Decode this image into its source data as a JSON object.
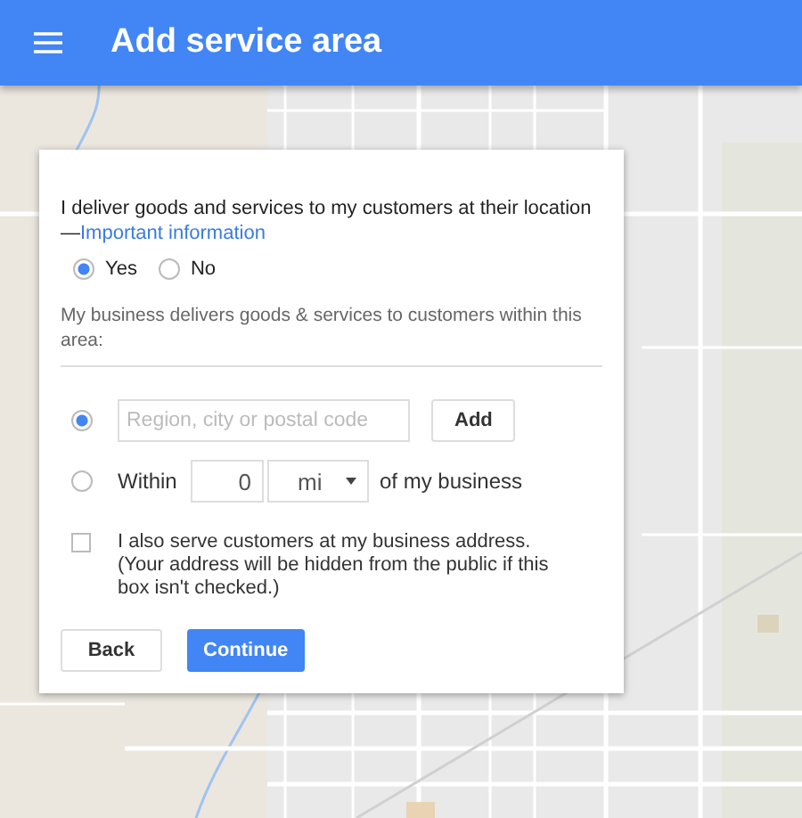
{
  "header": {
    "title": "Add service area"
  },
  "dialog": {
    "question": "I deliver goods and services to my customers at their location",
    "dash": "—",
    "link": "Important information",
    "delivery_options": [
      {
        "label": "Yes",
        "selected": true
      },
      {
        "label": "No",
        "selected": false
      }
    ],
    "area_prompt": "My business delivers goods & services to customers within this area:",
    "area_options": [
      {
        "kind": "region",
        "selected": true,
        "placeholder": "Region, city or postal code",
        "button": "Add"
      },
      {
        "kind": "radius",
        "selected": false,
        "label": "Within",
        "distance": "0",
        "unit": "mi",
        "suffix": "of my business"
      }
    ],
    "also_serve": {
      "label": "I also serve customers at my business address. (Your address will be hidden from the public if this box isn't checked.)",
      "checked": false
    },
    "buttons": [
      {
        "label": "Back",
        "kind": "secondary"
      },
      {
        "label": "Continue",
        "kind": "primary"
      }
    ]
  }
}
